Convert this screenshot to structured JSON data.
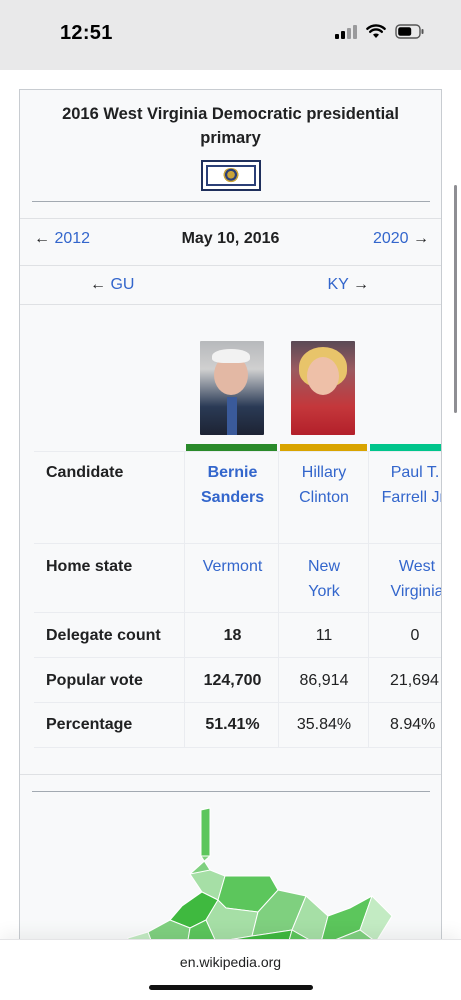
{
  "status_bar": {
    "time": "12:51",
    "signal_icon": "cellular-signal-icon",
    "wifi_icon": "wifi-icon",
    "battery_icon": "battery-icon"
  },
  "infobox": {
    "title": "2016 West Virginia Democratic presidential primary",
    "flag_icon": "west-virginia-flag-icon",
    "nav": {
      "prev_year": "2012",
      "date": "May 10, 2016",
      "next_year": "2020",
      "prev_state": "GU",
      "next_state": "KY",
      "arrow_left": "←",
      "arrow_right": "→"
    },
    "rows": {
      "candidate": {
        "label": "Candidate",
        "values": [
          "Bernie Sanders",
          "Hillary Clinton",
          "Paul T. Farrell Jr."
        ]
      },
      "home_state": {
        "label": "Home state",
        "values": [
          "Vermont",
          "New York",
          "West Virginia"
        ]
      },
      "delegate_count": {
        "label": "Delegate count",
        "values": [
          "18",
          "11",
          "0"
        ]
      },
      "popular_vote": {
        "label": "Popular vote",
        "values": [
          "124,700",
          "86,914",
          "21,694"
        ]
      },
      "percentage": {
        "label": "Percentage",
        "values": [
          "51.41%",
          "35.84%",
          "8.94%"
        ]
      }
    },
    "candidate_colors": [
      "#2a8a2a",
      "#d9a400",
      "#00c58b"
    ],
    "map_colors": [
      "#7fd07f",
      "#5cc65c",
      "#3fb93f",
      "#a6dfa6",
      "#c3ebc3"
    ]
  },
  "url_bar": {
    "domain": "en.wikipedia.org"
  }
}
